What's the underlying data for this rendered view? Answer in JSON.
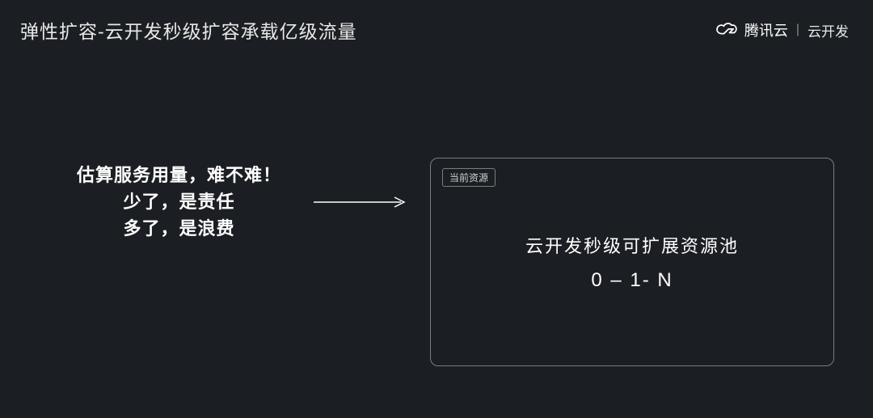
{
  "header": {
    "title": "弹性扩容-云开发秒级扩容承载亿级流量",
    "brand_main": "腾讯云",
    "brand_divider": "|",
    "brand_sub": "云开发"
  },
  "left": {
    "line1": "估算服务用量，难不难！",
    "line2": "少了，是责任",
    "line3": "多了，是浪费"
  },
  "panel": {
    "badge": "当前资源",
    "line1": "云开发秒级可扩展资源池",
    "line2": "0 – 1- N"
  }
}
